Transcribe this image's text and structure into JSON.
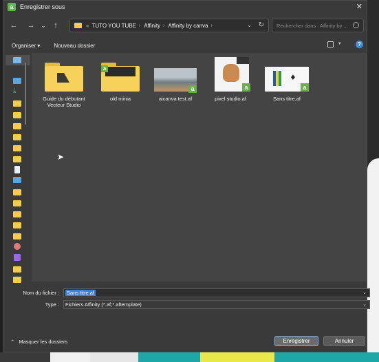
{
  "window": {
    "title": "Enregistrer sous",
    "app_icon": "a",
    "close": "✕"
  },
  "nav": {
    "back": "←",
    "forward": "→",
    "dropdown": "⌄",
    "up": "↑"
  },
  "address": {
    "overflow": "«",
    "breadcrumbs": [
      "TUTO YOU TUBE",
      "Affinity",
      "Affinity by canva"
    ],
    "separator": "›",
    "dropdown": "⌄",
    "refresh": "↻"
  },
  "search": {
    "placeholder": "Rechercher dans : Affinity by ..."
  },
  "toolbar": {
    "organize_label": "Organiser ▾",
    "new_folder_label": "Nouveau dossier",
    "view_drop": "▾",
    "help": "?"
  },
  "files": [
    {
      "name": "Guide du débutant Vecteur Studio",
      "kind": "folder"
    },
    {
      "name": "old minia",
      "kind": "folder",
      "badge": "a"
    },
    {
      "name": "aicanva test.af",
      "kind": "file",
      "badge": "a"
    },
    {
      "name": "pixel studio.af",
      "kind": "file",
      "badge": "a"
    },
    {
      "name": "Sans titre.af",
      "kind": "file",
      "badge": "a"
    }
  ],
  "form": {
    "filename_label": "Nom du fichier :",
    "filename_value": "Sans titre.af",
    "type_label": "Type :",
    "type_value": "Fichiers Affinity (*.af;*.aftemplate)",
    "drop": "⌄"
  },
  "footer": {
    "hide_folders_label": "Masquer les dossiers",
    "hide_icon": "⌃",
    "save_label": "Enregistrer",
    "cancel_label": "Annuler"
  },
  "colors": {
    "accent": "#3f7fd6",
    "folder": "#f6d25a",
    "affinity_green": "#6ab04c",
    "dialog_bg": "#3a3a3a",
    "pane_bg": "#444444"
  }
}
